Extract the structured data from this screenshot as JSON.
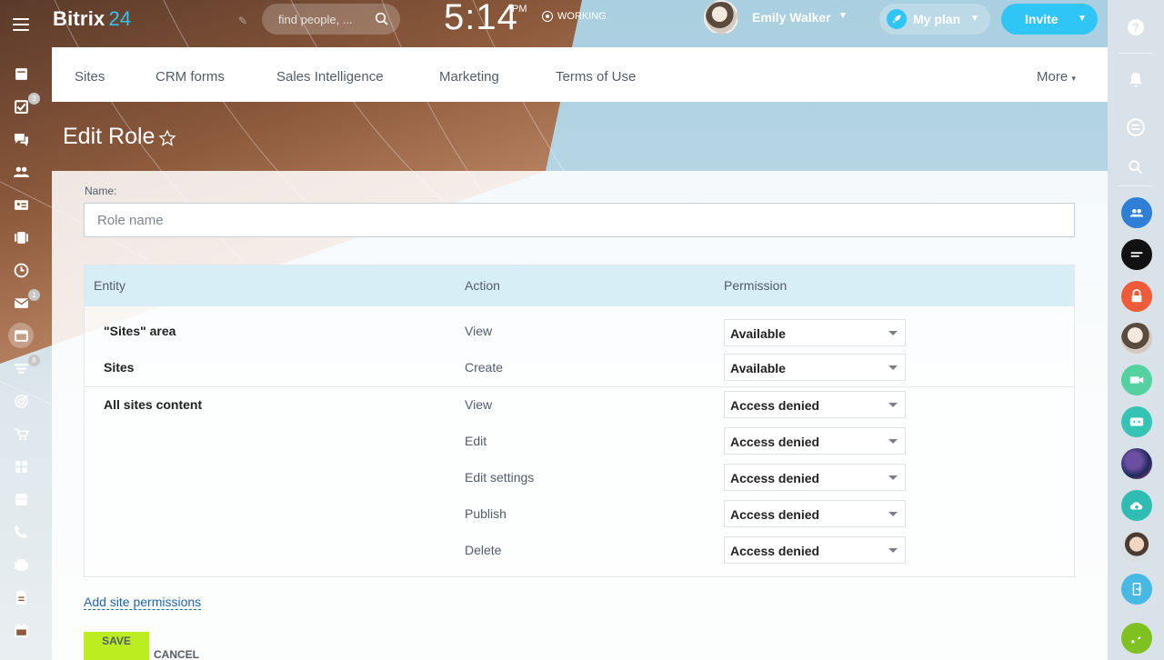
{
  "app": {
    "logo_name": "Bitrix",
    "logo_num": "24",
    "clock": "5:14",
    "clock_ampm": "PM",
    "work_status": "WORKING",
    "user_name": "Emily Walker"
  },
  "left_sidebar": {
    "badges": {
      "tasks": "3",
      "mail": "1",
      "filter": "8"
    },
    "icons": [
      "menu-icon",
      "feed-icon",
      "tasks-icon",
      "chat-icon",
      "employees-icon",
      "contacts-icon",
      "video-icon",
      "clock-icon",
      "mail-icon",
      "sites-icon",
      "filter-icon",
      "target-icon",
      "cart-icon",
      "apps-icon",
      "store-icon",
      "phone-icon",
      "print-icon",
      "docs-icon",
      "calendar-icon"
    ]
  },
  "search": {
    "placeholder": "find people, ..."
  },
  "header_buttons": {
    "myplan": "My plan",
    "invite": "Invite"
  },
  "nav": {
    "items": [
      "Sites",
      "CRM forms",
      "Sales Intelligence",
      "Marketing",
      "Terms of Use"
    ],
    "more": "More"
  },
  "page": {
    "title": "Edit Role"
  },
  "form": {
    "name_label": "Name:",
    "name_placeholder": "Role name",
    "name_value": ""
  },
  "table": {
    "headers": {
      "entity": "Entity",
      "action": "Action",
      "permission": "Permission"
    },
    "rows": [
      {
        "entity": "\"Sites\" area",
        "action": "View",
        "permission": "Available"
      },
      {
        "entity": "Sites",
        "action": "Create",
        "permission": "Available"
      },
      {
        "entity": "All sites content",
        "action": "View",
        "permission": "Access denied"
      },
      {
        "entity": "",
        "action": "Edit",
        "permission": "Access denied"
      },
      {
        "entity": "",
        "action": "Edit settings",
        "permission": "Access denied"
      },
      {
        "entity": "",
        "action": "Publish",
        "permission": "Access denied"
      },
      {
        "entity": "",
        "action": "Delete",
        "permission": "Access denied"
      }
    ]
  },
  "actions": {
    "add_link": "Add site permissions",
    "save": "SAVE",
    "cancel": "CANCEL"
  },
  "colors": {
    "accent": "#2fc6f6",
    "save_button": "#bbed21",
    "table_header": "#d8eef7",
    "link": "#2067b0"
  }
}
